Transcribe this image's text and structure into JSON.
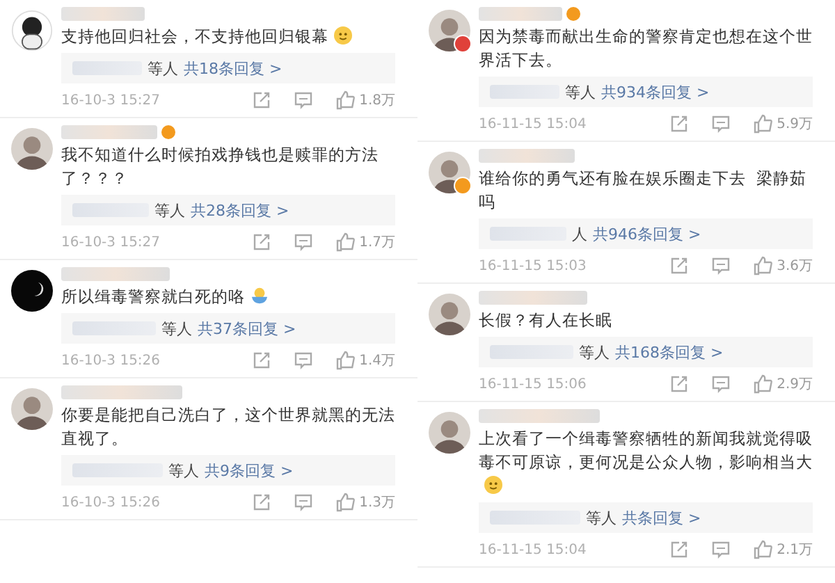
{
  "columns": [
    {
      "comments": [
        {
          "avatar": {
            "kind": "cartoon"
          },
          "name_badge": false,
          "text": "支持他回归社会，不支持他回归银幕",
          "emoji": {
            "kind": "smile"
          },
          "reply_suffix": "等人",
          "reply_count": "共18条回复 >",
          "time": "16-10-3 15:27",
          "likes": "1.8万"
        },
        {
          "avatar": {
            "kind": "photo"
          },
          "name_badge": true,
          "text": "我不知道什么时候拍戏挣钱也是赎罪的方法了？？？",
          "reply_suffix": "等人",
          "reply_count": "共28条回复 >",
          "time": "16-10-3 15:27",
          "likes": "1.7万"
        },
        {
          "avatar": {
            "kind": "dark"
          },
          "name_badge": false,
          "text": "所以缉毒警察就白死的咯",
          "emoji": {
            "kind": "bowl"
          },
          "reply_suffix": "等人",
          "reply_count": "共37条回复 >",
          "time": "16-10-3 15:26",
          "likes": "1.4万"
        },
        {
          "avatar": {
            "kind": "photo"
          },
          "name_badge": false,
          "text": "你要是能把自己洗白了，这个世界就黑的无法直视了。",
          "reply_suffix": "等人",
          "reply_count": "共9条回复 >",
          "time": "16-10-3 15:26",
          "likes": "1.3万"
        }
      ]
    },
    {
      "comments": [
        {
          "avatar": {
            "kind": "photo",
            "color": "#e0413a"
          },
          "name_badge": true,
          "text": "因为禁毒而献出生命的警察肯定也想在这个世界活下去。",
          "reply_suffix": "等人",
          "reply_count": "共934条回复 >",
          "time": "16-11-15 15:04",
          "likes": "5.9万"
        },
        {
          "avatar": {
            "kind": "photo",
            "color": "#f39a1e"
          },
          "name_badge": false,
          "text": "谁给你的勇气还有脸在娱乐圈走下去  梁静茹吗",
          "reply_suffix": "人",
          "reply_count": "共946条回复 >",
          "time": "16-11-15 15:03",
          "likes": "3.6万"
        },
        {
          "avatar": {
            "kind": "photo"
          },
          "name_badge": false,
          "text": "长假？有人在长眠",
          "reply_suffix": "等人",
          "reply_count": "共168条回复 >",
          "time": "16-11-15 15:06",
          "likes": "2.9万"
        },
        {
          "avatar": {
            "kind": "photo"
          },
          "name_badge": false,
          "text": "上次看了一个缉毒警察牺牲的新闻我就觉得吸毒不可原谅，更何况是公众人物，影响相当大",
          "emoji": {
            "kind": "smile"
          },
          "reply_suffix": "等人",
          "reply_count": "共条回复 >",
          "time": "16-11-15 15:04",
          "likes": "2.1万"
        }
      ]
    }
  ]
}
